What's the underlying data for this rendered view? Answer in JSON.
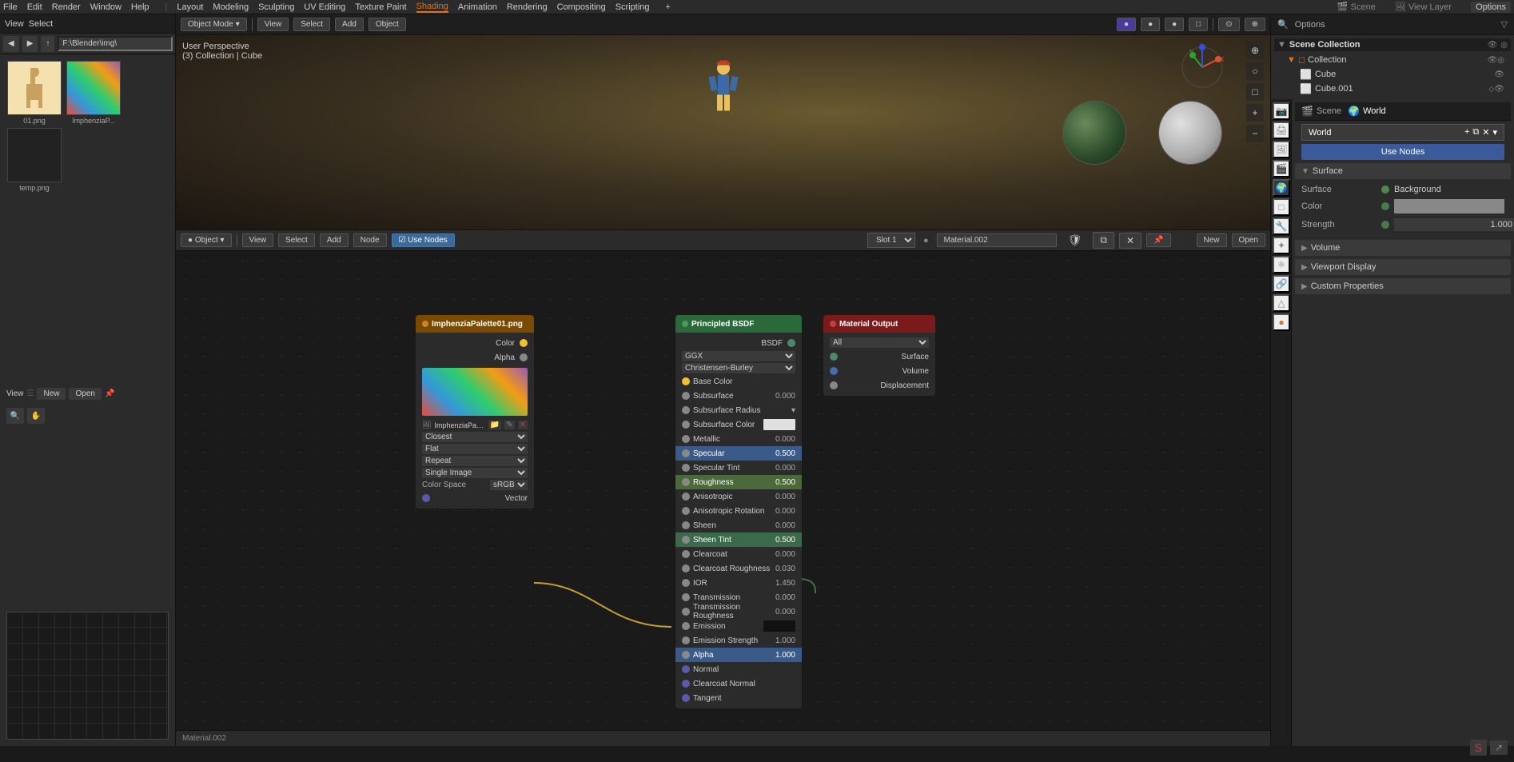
{
  "topMenu": {
    "items": [
      "File",
      "Edit",
      "Render",
      "Window",
      "Help"
    ],
    "layout_label": "Layout",
    "modeling_label": "Modeling",
    "sculpting_label": "Sculpting",
    "uv_editing_label": "UV Editing",
    "texture_paint_label": "Texture Paint",
    "shading_label": "Shading",
    "animation_label": "Animation",
    "rendering_label": "Rendering",
    "compositing_label": "Compositing",
    "scripting_label": "Scripting",
    "add_label": "+"
  },
  "leftPanel": {
    "header_items": [
      "View",
      "Select"
    ],
    "file_path": "F:\\Blender\\img\\",
    "thumbnails": [
      {
        "label": "01.png",
        "type": "giraffe"
      },
      {
        "label": "ImphenziaP...",
        "type": "palette"
      },
      {
        "label": "temp.png",
        "type": "dark"
      }
    ],
    "new_btn": "New",
    "open_btn": "Open"
  },
  "viewport": {
    "mode": "Object Mode",
    "view_btn": "View",
    "select_btn": "Select",
    "add_btn": "Add",
    "object_btn": "Object",
    "info": "User Perspective",
    "collection_info": "(3) Collection | Cube"
  },
  "nodeEditor": {
    "header": {
      "object_btn": "Object",
      "view_btn": "View",
      "select_btn": "Select",
      "add_btn": "Add",
      "node_btn": "Node",
      "use_nodes_label": "Use Nodes",
      "slot_label": "Slot 1",
      "material_name": "Material.002",
      "new_btn": "New",
      "open_btn": "Open"
    },
    "nodes": {
      "imageTexture": {
        "title": "ImphenziaP alette01.png",
        "short_title": "ImphenziaPalett...",
        "outputs": [
          "Color",
          "Alpha"
        ],
        "interpolation": "Closest",
        "projection": "Flat",
        "extension": "Repeat",
        "source": "Single Image",
        "color_space": "sRGB",
        "vector_input": "Vector"
      },
      "principledBSDF": {
        "title": "Principled BSDF",
        "type": "BSDF",
        "distribution": "GGX",
        "subsystem": "Christensen-Burley",
        "inputs": [
          {
            "name": "Base Color",
            "value": "",
            "has_socket": true
          },
          {
            "name": "Subsurface",
            "value": "0.000"
          },
          {
            "name": "Subsurface Radius",
            "value": "",
            "has_dropdown": true
          },
          {
            "name": "Subsurface Color",
            "value": "",
            "has_color": true
          },
          {
            "name": "Metallic",
            "value": "0.000"
          },
          {
            "name": "Specular",
            "value": "0.500",
            "highlighted": true
          },
          {
            "name": "Specular Tint",
            "value": "0.000"
          },
          {
            "name": "Roughness",
            "value": "0.500",
            "highlighted": true
          },
          {
            "name": "Anisotropic",
            "value": "0.000"
          },
          {
            "name": "Anisotropic Rotation",
            "value": "0.000"
          },
          {
            "name": "Sheen",
            "value": "0.000"
          },
          {
            "name": "Sheen Tint",
            "value": "0.500",
            "highlighted": true
          },
          {
            "name": "Clearcoat",
            "value": "0.000"
          },
          {
            "name": "Clearcoat Roughness",
            "value": "0.030"
          },
          {
            "name": "IOR",
            "value": "1.450"
          },
          {
            "name": "Transmission",
            "value": "0.000"
          },
          {
            "name": "Transmission Roughness",
            "value": "0.000"
          },
          {
            "name": "Emission",
            "value": "",
            "has_color_dark": true
          },
          {
            "name": "Emission Strength",
            "value": "1.000"
          },
          {
            "name": "Alpha",
            "value": "1.000",
            "highlighted": true
          },
          {
            "name": "Normal",
            "value": ""
          },
          {
            "name": "Clearcoat Normal",
            "value": ""
          },
          {
            "name": "Tangent",
            "value": ""
          }
        ]
      },
      "materialOutput": {
        "title": "Material Output",
        "dropdown_value": "All",
        "outputs": [
          "Surface",
          "Volume",
          "Displacement"
        ]
      }
    }
  },
  "rightPanel": {
    "options_btn": "Options",
    "scene_collection_title": "Scene Collection",
    "collection_label": "Collection",
    "cube_label": "Cube",
    "cube001_label": "Cube.001",
    "scene_label": "Scene",
    "world_label": "World",
    "view_layer_label": "View Layer",
    "world_name": "World",
    "surface_label": "Surface",
    "background_label": "Background",
    "use_nodes_btn": "Use Nodes",
    "color_label": "Color",
    "strength_label": "Strength",
    "strength_value": "1.000",
    "volume_label": "Volume",
    "viewport_display_label": "Viewport Display",
    "custom_props_label": "Custom Properties"
  },
  "statusBar": {
    "material_label": "Material.002"
  }
}
